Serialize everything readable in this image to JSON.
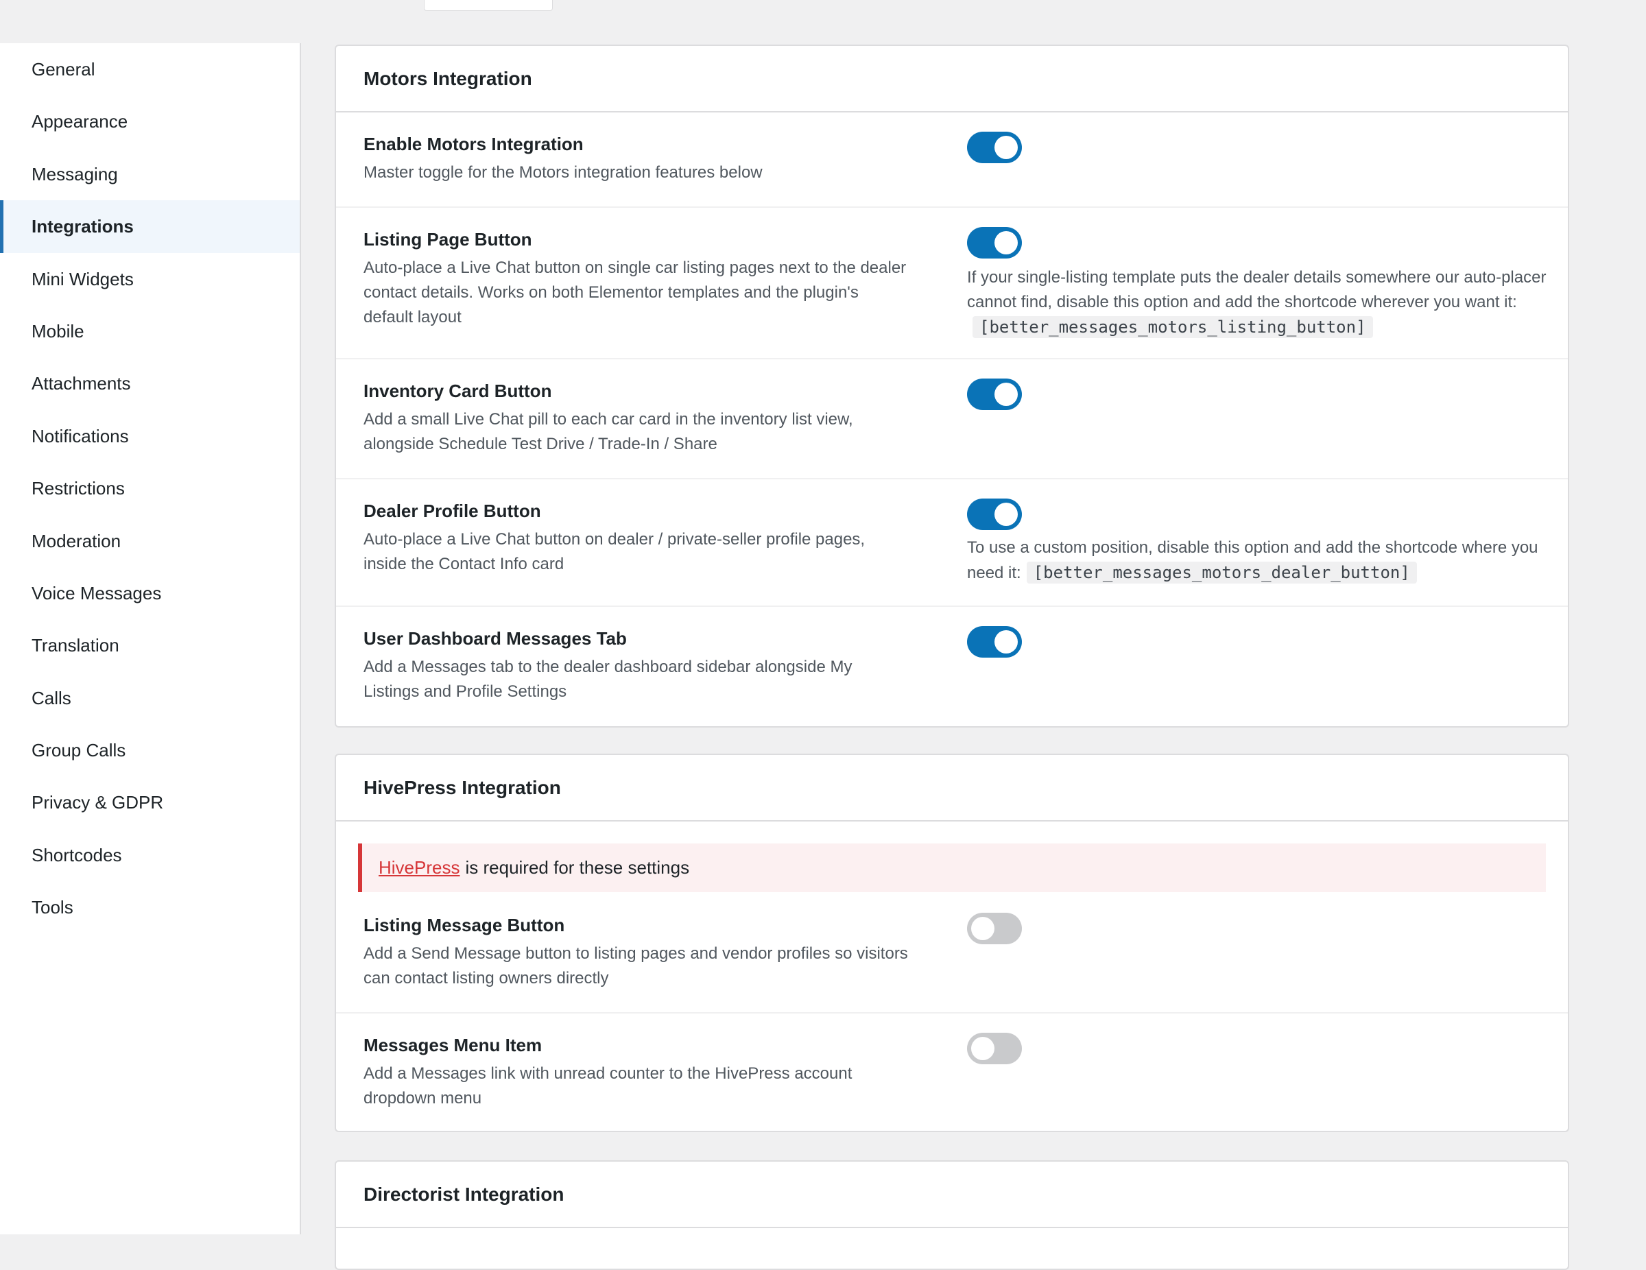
{
  "sidebar": {
    "items": [
      {
        "label": "General"
      },
      {
        "label": "Appearance"
      },
      {
        "label": "Messaging"
      },
      {
        "label": "Integrations"
      },
      {
        "label": "Mini Widgets"
      },
      {
        "label": "Mobile"
      },
      {
        "label": "Attachments"
      },
      {
        "label": "Notifications"
      },
      {
        "label": "Restrictions"
      },
      {
        "label": "Moderation"
      },
      {
        "label": "Voice Messages"
      },
      {
        "label": "Translation"
      },
      {
        "label": "Calls"
      },
      {
        "label": "Group Calls"
      },
      {
        "label": "Privacy & GDPR"
      },
      {
        "label": "Shortcodes"
      },
      {
        "label": "Tools"
      }
    ],
    "active": "Integrations"
  },
  "motors": {
    "title": "Motors Integration",
    "rows": [
      {
        "title": "Enable Motors Integration",
        "description": "Master toggle for the Motors integration features below",
        "enabled": true
      },
      {
        "title": "Listing Page Button",
        "description": "Auto-place a Live Chat button on single car listing pages next to the dealer contact details. Works on both Elementor templates and the plugin's default layout",
        "enabled": true,
        "help": "If your single-listing template puts the dealer details somewhere our auto-placer cannot find, disable this option and add the shortcode wherever you want it:",
        "shortcode": "[better_messages_motors_listing_button]"
      },
      {
        "title": "Inventory Card Button",
        "description": "Add a small Live Chat pill to each car card in the inventory list view, alongside Schedule Test Drive / Trade-In / Share",
        "enabled": true
      },
      {
        "title": "Dealer Profile Button",
        "description": "Auto-place a Live Chat button on dealer / private-seller profile pages, inside the Contact Info card",
        "enabled": true,
        "help": "To use a custom position, disable this option and add the shortcode where you need it:",
        "shortcode": "[better_messages_motors_dealer_button]"
      },
      {
        "title": "User Dashboard Messages Tab",
        "description": "Add a Messages tab to the dealer dashboard sidebar alongside My Listings and Profile Settings",
        "enabled": true
      }
    ]
  },
  "hivepress": {
    "title": "HivePress Integration",
    "notice_link": "HivePress",
    "notice_text": "is required for these settings",
    "rows": [
      {
        "title": "Listing Message Button",
        "description": "Add a Send Message button to listing pages and vendor profiles so visitors can contact listing owners directly",
        "enabled": false
      },
      {
        "title": "Messages Menu Item",
        "description": "Add a Messages link with unread counter to the HivePress account dropdown menu",
        "enabled": false
      }
    ]
  },
  "directorist": {
    "title": "Directorist Integration"
  },
  "colors": {
    "accent": "#0a73b7",
    "toggle_off": "#c9cacc",
    "notice_border": "#d63638",
    "notice_bg": "#fcf0f1",
    "active_nav_bg": "#f0f6fc"
  }
}
